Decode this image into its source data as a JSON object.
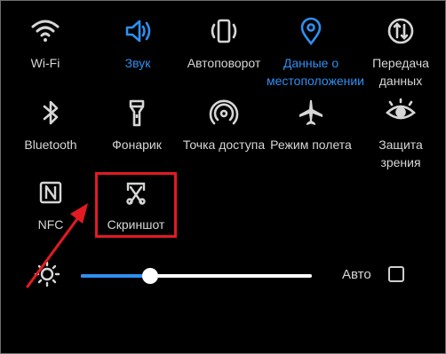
{
  "tiles": [
    {
      "label": "Wi-Fi",
      "icon": "wifi-icon",
      "active": false
    },
    {
      "label": "Звук",
      "icon": "sound-icon",
      "active": true
    },
    {
      "label": "Автоповорот",
      "icon": "auto-rotate-icon",
      "active": false
    },
    {
      "label": "Данные о местоположении",
      "icon": "location-icon",
      "active": true
    },
    {
      "label": "Передача данных",
      "icon": "data-transfer-icon",
      "active": false
    },
    {
      "label": "Bluetooth",
      "icon": "bluetooth-icon",
      "active": false
    },
    {
      "label": "Фонарик",
      "icon": "flashlight-icon",
      "active": false
    },
    {
      "label": "Точка доступа",
      "icon": "hotspot-icon",
      "active": false
    },
    {
      "label": "Режим полета",
      "icon": "airplane-icon",
      "active": false
    },
    {
      "label": "Защита зрения",
      "icon": "eye-icon",
      "active": false
    },
    {
      "label": "NFC",
      "icon": "nfc-icon",
      "active": false
    },
    {
      "label": "Скриншот",
      "icon": "screenshot-icon",
      "active": false
    }
  ],
  "brightness": {
    "level": 0.3,
    "auto_label": "Авто",
    "auto_checked": false,
    "icon": "brightness-icon"
  },
  "colors": {
    "background": "#000000",
    "text": "#d6d6d6",
    "accent": "#2f8ff0",
    "annotation": "#e21b22"
  }
}
